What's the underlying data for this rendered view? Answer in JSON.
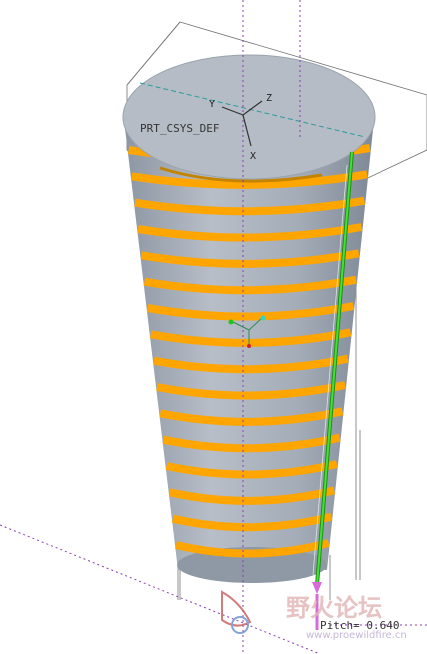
{
  "viewport": {
    "csys_label": "PRT_CSYS_DEF",
    "axis_y": "Y",
    "axis_z": "Z",
    "axis_x": "X",
    "pitch_label": "Pitch= 0.640"
  },
  "watermark": {
    "cn_text": "野火论坛",
    "url_text": "www.proewildfire.cn"
  },
  "colors": {
    "body": "#a9b2bd",
    "top_cap": "#b5bcc5",
    "thread": "#ffa500",
    "trajectory": "#2ecc1f",
    "datum_plane": "#707070",
    "axis": "#5a3ea8",
    "dashed_axis": "#2a9c9c"
  }
}
